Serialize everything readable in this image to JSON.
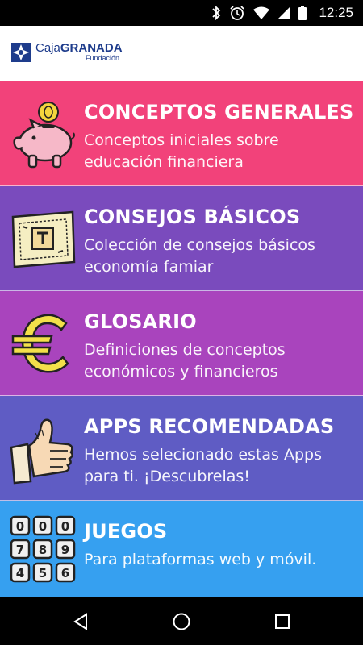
{
  "status_bar": {
    "time": "12:25",
    "icons": [
      "bluetooth-icon",
      "alarm-icon",
      "wifi-icon",
      "cell-signal-icon",
      "battery-icon"
    ]
  },
  "header": {
    "logo_brand": "Caja",
    "logo_brand_bold": "GRANADA",
    "logo_sub": "Fundación"
  },
  "menu": [
    {
      "title": "CONCEPTOS GENERALES",
      "description": "Conceptos iniciales sobre educación financiera",
      "icon": "piggy-bank-icon",
      "color": "#f2427a"
    },
    {
      "title": "CONSEJOS BÁSICOS",
      "description": "Colección de consejos básicos economía famiar",
      "icon": "banknote-icon",
      "color": "#7a4bbd"
    },
    {
      "title": "GLOSARIO",
      "description": "Definiciones de conceptos económicos y financieros",
      "icon": "euro-icon",
      "color": "#a944bd"
    },
    {
      "title": "APPS RECOMENDADAS",
      "description": "Hemos selecionado estas Apps para ti. ¡Descubrelas!",
      "icon": "thumbs-up-icon",
      "color": "#5f5cc4"
    },
    {
      "title": "JUEGOS",
      "description": "Para plataformas web y móvil.",
      "icon": "keypad-icon",
      "color": "#36a0f0"
    }
  ],
  "keypad_digits": [
    "0",
    "0",
    "0",
    "7",
    "8",
    "9",
    "4",
    "5",
    "6"
  ],
  "nav_bar": {
    "buttons": [
      "back-icon",
      "home-icon",
      "recents-icon"
    ]
  }
}
